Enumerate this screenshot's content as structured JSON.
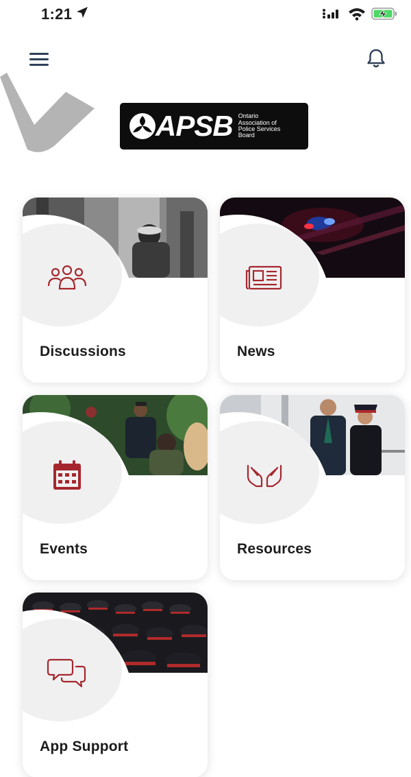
{
  "status_bar": {
    "time": "1:21",
    "icons": [
      "location-arrow-icon",
      "cellular-signal-icon",
      "wifi-icon",
      "battery-charging-icon"
    ]
  },
  "header": {
    "menu_icon": "hamburger-menu-icon",
    "bell_icon": "bell-icon"
  },
  "logo": {
    "mark": "APSB",
    "line1": "Ontario",
    "line2": "Association of",
    "line3": "Police Services",
    "line4": "Board"
  },
  "tiles": [
    {
      "label": "Discussions",
      "icon": "people-group-icon"
    },
    {
      "label": "News",
      "icon": "newspaper-icon"
    },
    {
      "label": "Events",
      "icon": "calendar-icon"
    },
    {
      "label": "Resources",
      "icon": "helping-hands-icon"
    },
    {
      "label": "App Support",
      "icon": "chat-bubbles-icon"
    }
  ],
  "colors": {
    "accent": "#a5272d",
    "tile_circle": "#f0f0f1",
    "header_icon": "#2e4058",
    "logo_bg": "#0d0d0d"
  }
}
